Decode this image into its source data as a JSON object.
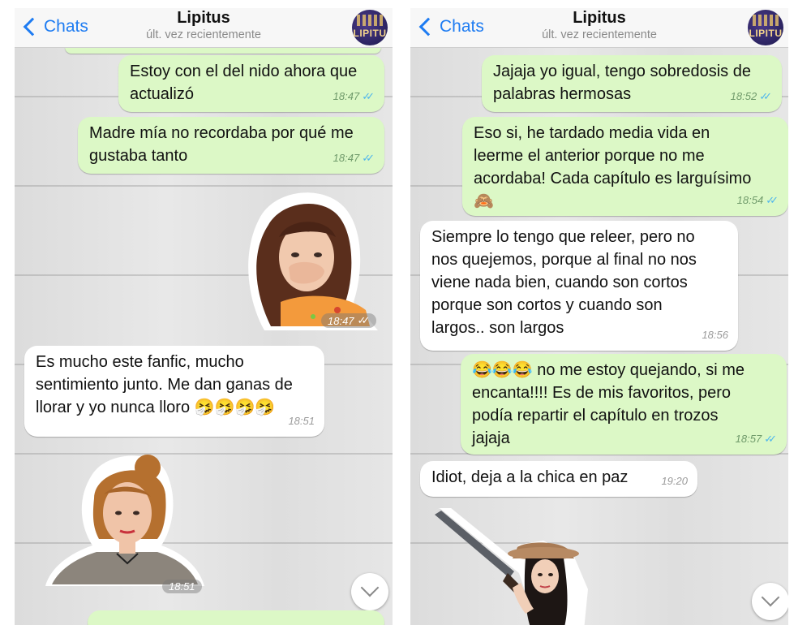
{
  "left": {
    "header": {
      "back_label": "Chats",
      "title": "Lipitus",
      "subtitle": "últ. vez recientemente",
      "avatar_text": "LIPITU"
    },
    "messages": [
      {
        "text": "Estoy con el del nido ahora que\nactualizó",
        "time": "18:47"
      },
      {
        "text": "Madre mía no recordaba por qué me\ngustaba tanto",
        "time": "18:47"
      },
      {
        "time": "18:47"
      },
      {
        "text": "Es mucho este fanfic, mucho\nsentimiento junto. Me dan ganas de\nllorar y yo nunca lloro",
        "emoji": "🤧🤧🤧🤧",
        "time": "18:51"
      },
      {
        "time": "18:51"
      }
    ]
  },
  "right": {
    "header": {
      "back_label": "Chats",
      "title": "Lipitus",
      "subtitle": "últ. vez recientemente",
      "avatar_text": "LIPITU"
    },
    "messages": [
      {
        "text": "Jajaja yo igual, tengo sobredosis de\npalabras hermosas",
        "time": "18:52"
      },
      {
        "text": "Eso si, he tardado media vida en\nleerme el anterior porque no me\nacordaba! Cada capítulo es larguísimo",
        "emoji": "🙈",
        "time": "18:54"
      },
      {
        "text": "Siempre lo tengo que releer, pero no\nnos quejemos,  porque al final no nos\nviene nada bien, cuando son cortos\nporque son cortos y cuando son\nlargos.. son largos",
        "time": "18:56"
      },
      {
        "emoji": "😂😂😂",
        "text": " no me estoy quejando, si me\nencanta!!!! Es de mis favoritos, pero\npodía repartir el capítulo en trozos\njajaja",
        "time": "18:57"
      },
      {
        "text": "Idiot, deja a la chica en paz",
        "time": "19:20"
      }
    ]
  },
  "colors": {
    "outgoing": "#dcf8c6",
    "incoming": "#ffffff",
    "accent": "#1e7cf2",
    "read_ticks": "#4fb6ec"
  },
  "icons": [
    "back-chevron-icon",
    "double-check-icon",
    "scroll-down-icon"
  ]
}
